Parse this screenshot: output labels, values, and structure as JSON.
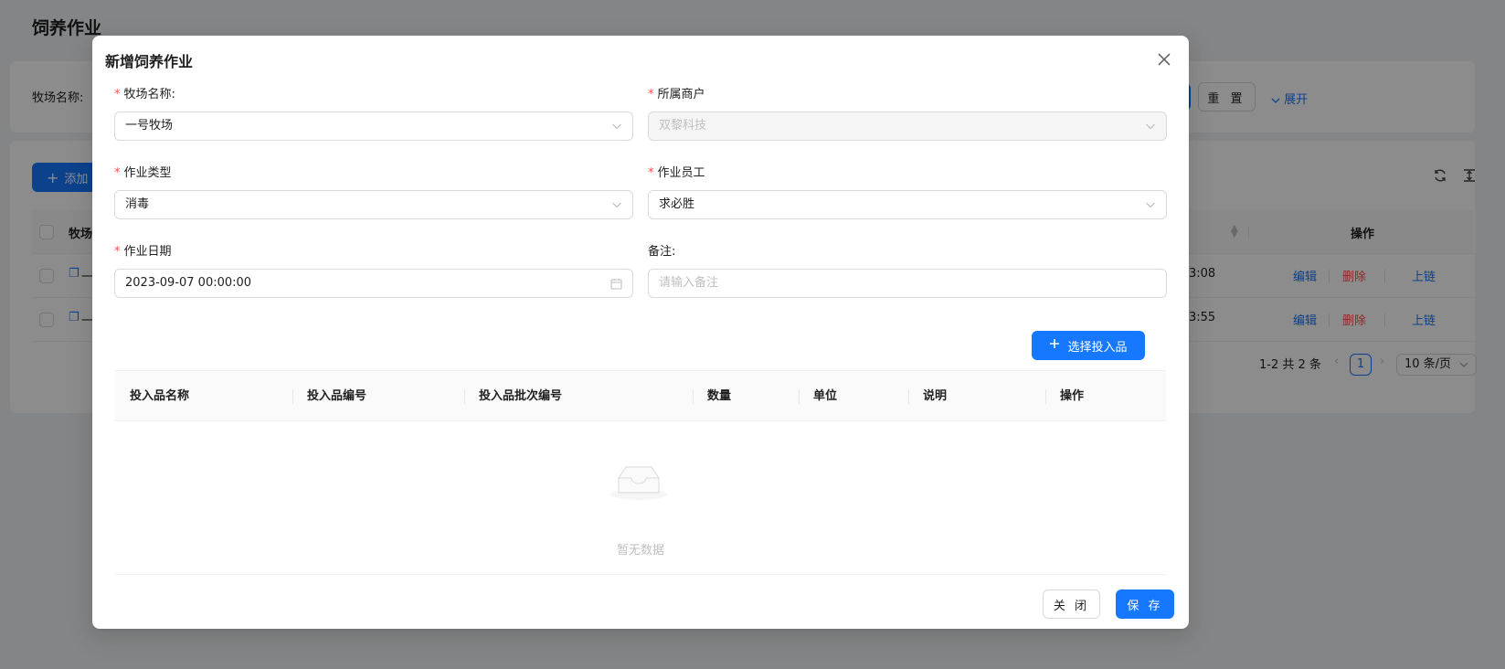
{
  "page": {
    "title": "饲养作业",
    "search_label": "牧场名称:",
    "reset_label": "重 置",
    "expand_label": "展开",
    "add_label": "添加",
    "table_header_first": "牧场",
    "table_header_actions": "操作",
    "rows": [
      {
        "prefix": "一",
        "time_tail": "3:08",
        "edit": "编辑",
        "delete": "删除",
        "chain": "上链"
      },
      {
        "prefix": "一",
        "time_tail": "3:55",
        "edit": "编辑",
        "delete": "删除",
        "chain": "上链"
      }
    ],
    "pagination": {
      "summary": "1-2 共 2 条",
      "current_page": "1",
      "page_size": "10 条/页"
    }
  },
  "modal": {
    "title": "新增饲养作业",
    "fields": {
      "ranch": {
        "label": "牧场名称:",
        "value": "一号牧场",
        "required": true
      },
      "merchant": {
        "label": "所属商户",
        "value": "双黎科技",
        "required": true,
        "disabled": true
      },
      "work_type": {
        "label": "作业类型",
        "value": "消毒",
        "required": true
      },
      "employee": {
        "label": "作业员工",
        "value": "求必胜",
        "required": true
      },
      "date": {
        "label": "作业日期",
        "value": "2023-09-07 00:00:00",
        "required": true
      },
      "remark": {
        "label": "备注:",
        "value": "",
        "placeholder": "请输入备注"
      }
    },
    "select_input_label": "选择投入品",
    "inputs_table": {
      "columns": [
        "投入品名称",
        "投入品编号",
        "投入品批次编号",
        "数量",
        "单位",
        "说明",
        "操作"
      ],
      "empty_text": "暂无数据"
    },
    "close_label": "关 闭",
    "save_label": "保 存"
  },
  "colors": {
    "primary": "#1677ff",
    "danger": "#ff4d4f",
    "mask": "rgba(0,0,0,0.45)"
  },
  "icons": [
    "close-icon",
    "chevron-down-icon",
    "calendar-icon",
    "plus-icon",
    "inbox-empty-icon",
    "refresh-icon",
    "column-height-icon",
    "copy-icon",
    "sort-icon",
    "left-arrow-icon",
    "right-arrow-icon"
  ]
}
